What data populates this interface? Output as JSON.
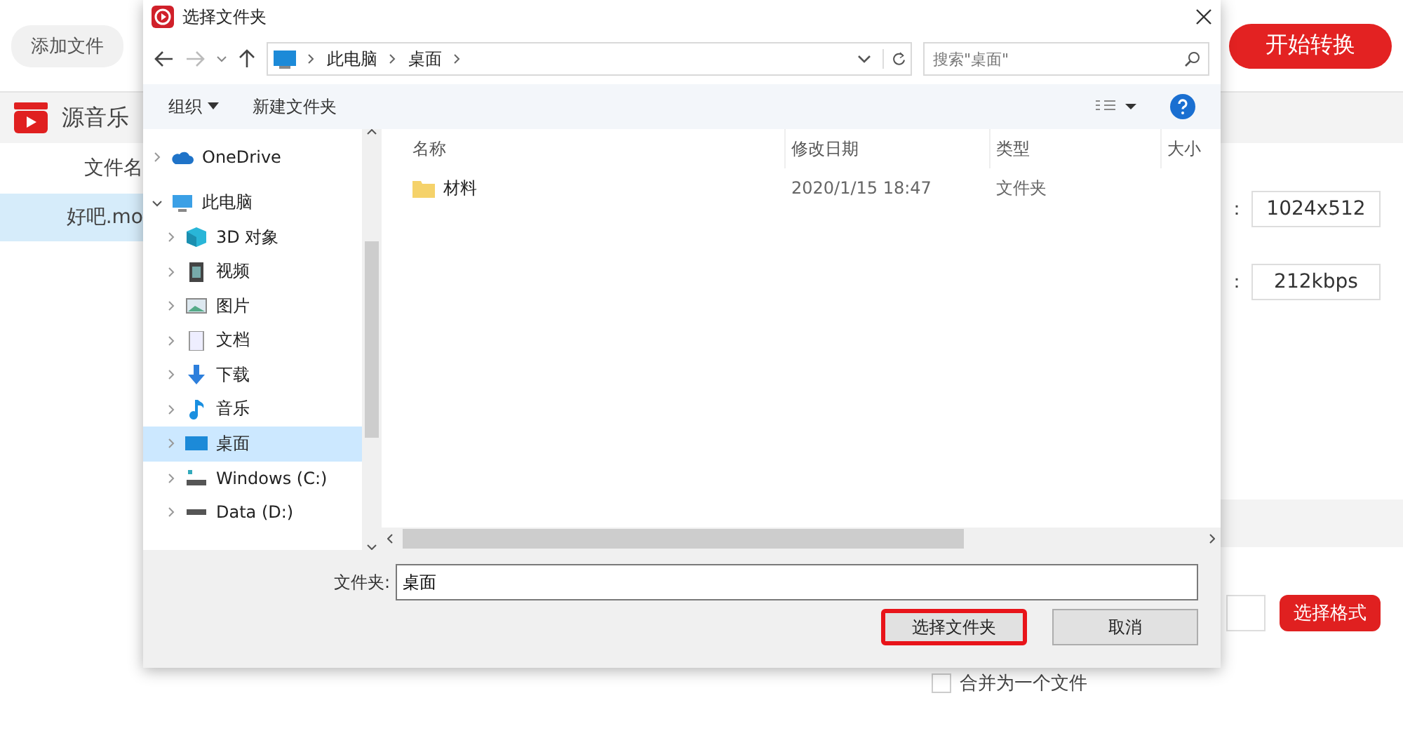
{
  "app": {
    "add_file_button": "添加文件",
    "start_button": "开始转换",
    "source_header": "源音乐",
    "file_table": {
      "column_1": "文件名",
      "rows": [
        {
          "name": "好吧.mo",
          "selected": true
        }
      ]
    },
    "settings": [
      {
        "label": "：",
        "value": "1024x512"
      },
      {
        "label": "：",
        "value": "212kbps"
      }
    ],
    "format_button": "选择格式",
    "merge_checkbox": {
      "label": "合并为一个文件",
      "checked": false
    }
  },
  "dialog": {
    "title": "选择文件夹",
    "breadcrumb": [
      "此电脑",
      "桌面"
    ],
    "search": {
      "placeholder": "搜索\"桌面\""
    },
    "toolbar": {
      "organize": "组织",
      "new_folder": "新建文件夹"
    },
    "nav": [
      {
        "label": "OneDrive",
        "kind": "cloud",
        "expanded": false,
        "selected": false
      },
      {
        "label": "此电脑",
        "kind": "pc",
        "expanded": true,
        "selected": false,
        "children": [
          {
            "label": "3D 对象",
            "kind": "cube",
            "expanded": false,
            "selected": false
          },
          {
            "label": "视频",
            "kind": "video",
            "expanded": false,
            "selected": false
          },
          {
            "label": "图片",
            "kind": "image",
            "expanded": false,
            "selected": false
          },
          {
            "label": "文档",
            "kind": "doc",
            "expanded": false,
            "selected": false
          },
          {
            "label": "下载",
            "kind": "download",
            "expanded": false,
            "selected": false
          },
          {
            "label": "音乐",
            "kind": "music",
            "expanded": false,
            "selected": false
          },
          {
            "label": "桌面",
            "kind": "desktop",
            "expanded": false,
            "selected": true
          },
          {
            "label": "Windows (C:)",
            "kind": "system-drive",
            "expanded": false,
            "selected": false
          },
          {
            "label": "Data (D:)",
            "kind": "drive",
            "expanded": false,
            "selected": false
          }
        ]
      }
    ],
    "columns": [
      "名称",
      "修改日期",
      "类型",
      "大小"
    ],
    "rows": [
      {
        "name": "材料",
        "modified": "2020/1/15 18:47",
        "type": "文件夹",
        "selected": false
      }
    ],
    "folder_field": {
      "label": "文件夹:",
      "value": "桌面"
    },
    "select_button": {
      "label": "选择文件夹",
      "highlighted": true
    },
    "cancel_button": "取消"
  }
}
